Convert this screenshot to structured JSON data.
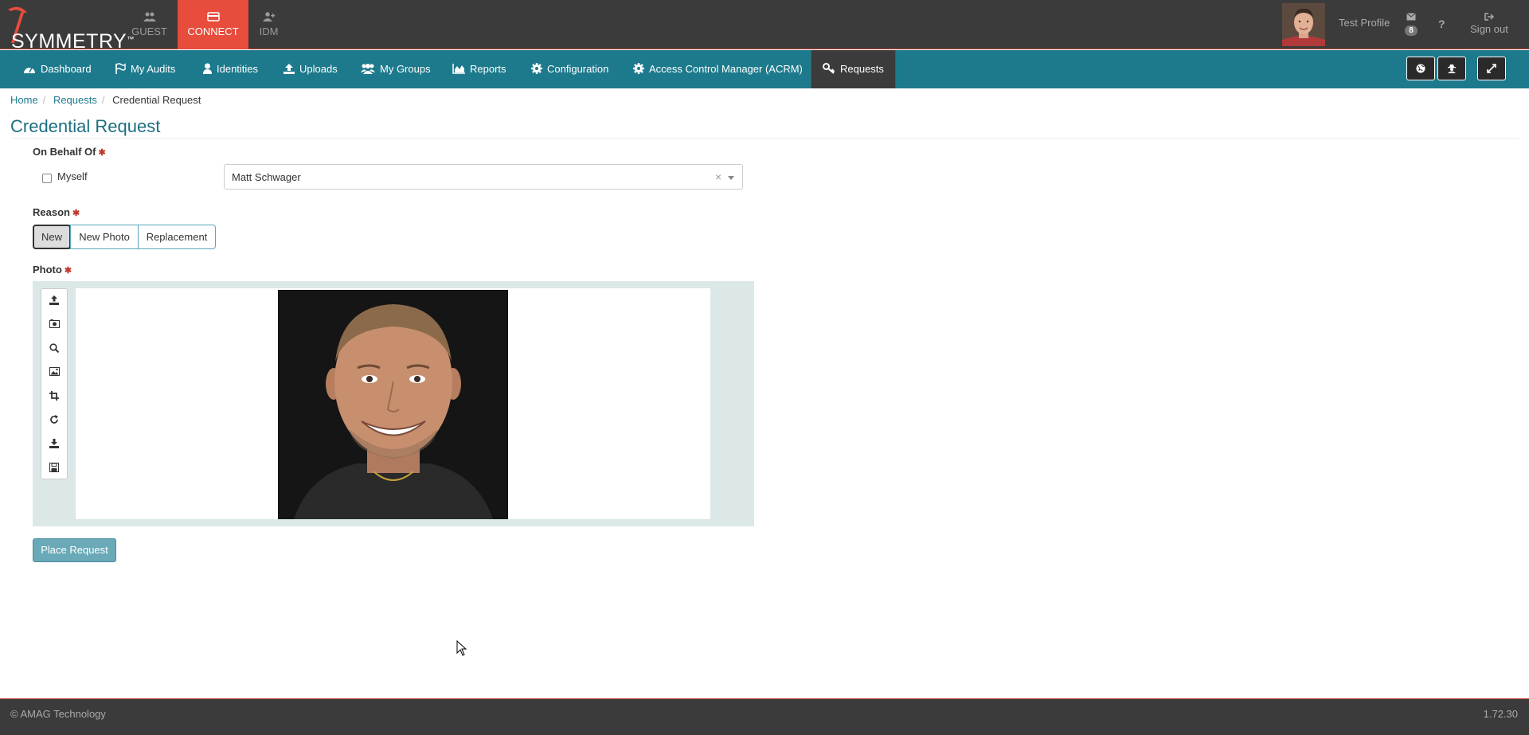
{
  "brand": {
    "name": "SYMMETRY",
    "tm": "™"
  },
  "apps": [
    {
      "label": "GUEST",
      "icon": "users-icon"
    },
    {
      "label": "CONNECT",
      "icon": "credit-card-icon",
      "active": true
    },
    {
      "label": "IDM",
      "icon": "user-plus-icon"
    }
  ],
  "user": {
    "name": "Test Profile",
    "mail_count": "8",
    "help": "?",
    "signout_label": "Sign out"
  },
  "nav": {
    "items": [
      {
        "label": "Dashboard",
        "icon": "tachometer-icon"
      },
      {
        "label": "My Audits",
        "icon": "flag-icon"
      },
      {
        "label": "Identities",
        "icon": "user-icon"
      },
      {
        "label": "Uploads",
        "icon": "upload-icon"
      },
      {
        "label": "My Groups",
        "icon": "group-icon"
      },
      {
        "label": "Reports",
        "icon": "area-chart-icon"
      },
      {
        "label": "Configuration",
        "icon": "gear-icon"
      },
      {
        "label": "Access Control Manager (ACRM)",
        "icon": "gear-icon"
      },
      {
        "label": "Requests",
        "icon": "key-icon",
        "active": true
      }
    ],
    "right_buttons": [
      "globe-icon",
      "user-secret-icon",
      "expand-icon"
    ]
  },
  "breadcrumb": {
    "home": "Home",
    "requests": "Requests",
    "current": "Credential Request"
  },
  "page": {
    "title": "Credential Request"
  },
  "form": {
    "on_behalf_label": "On Behalf Of",
    "myself_label": "Myself",
    "person_value": "Matt Schwager",
    "clear_symbol": "×",
    "reason_label": "Reason",
    "reasons": [
      "New",
      "New Photo",
      "Replacement"
    ],
    "reason_selected": "New",
    "photo_label": "Photo",
    "photo_tools": [
      "upload-icon",
      "camera-icon",
      "search-icon",
      "image-icon",
      "crop-icon",
      "rotate-icon",
      "download-icon",
      "save-icon"
    ],
    "submit_label": "Place Request"
  },
  "footer": {
    "copyright": "© AMAG Technology",
    "version": "1.72.30"
  },
  "colors": {
    "topbar": "#3b3b3b",
    "accent_red": "#e74c3c",
    "nav_teal": "#1d7a8c",
    "title_teal": "#1d6f82",
    "panel_bg": "#dbe8e7"
  }
}
